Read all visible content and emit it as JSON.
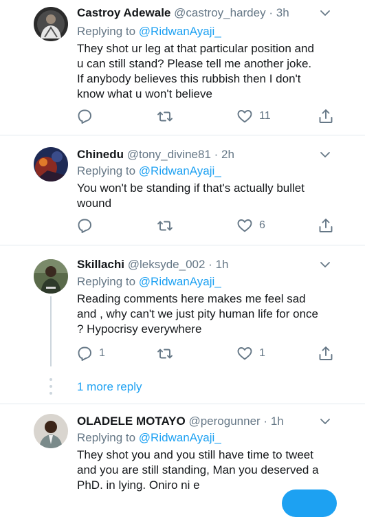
{
  "colors": {
    "accent": "#1da1f2",
    "secondary_text": "#657786",
    "primary_text": "#14171a",
    "divider": "#e1e8ed"
  },
  "icons": {
    "reply": "reply-icon",
    "retweet": "retweet-icon",
    "like": "heart-icon",
    "share": "share-icon",
    "menu": "chevron-down-icon"
  },
  "replies": [
    {
      "name": "Castroy Adewale",
      "handle": "@castroy_hardey",
      "separator": "·",
      "time": "3h",
      "replying_prefix": "Replying to ",
      "replying_to": "@RidwanAyaji_",
      "text_lines": [
        "They shot ur leg at that particular position and",
        "u can still stand? Please tell me another joke.",
        "If anybody believes this rubbish then I don't",
        "know what u won't believe"
      ],
      "reply_count": "",
      "retweet_count": "",
      "like_count": "11"
    },
    {
      "name": "Chinedu",
      "handle": "@tony_divine81",
      "separator": "·",
      "time": "2h",
      "replying_prefix": "Replying to ",
      "replying_to": "@RidwanAyaji_",
      "text_lines": [
        "You won't be standing if that's actually bullet",
        "wound"
      ],
      "reply_count": "",
      "retweet_count": "",
      "like_count": "6"
    },
    {
      "name": "Skillachi",
      "handle": "@leksyde_002",
      "separator": "·",
      "time": "1h",
      "replying_prefix": "Replying to ",
      "replying_to": "@RidwanAyaji_",
      "text_lines": [
        "Reading comments here makes me feel sad",
        "and , why can't we just pity human life for once",
        "? Hypocrisy everywhere"
      ],
      "reply_count": "1",
      "retweet_count": "",
      "like_count": "1"
    },
    {
      "name": "OLADELE MOTAYO",
      "handle": "@perogunner",
      "separator": "·",
      "time": "1h",
      "replying_prefix": "Replying to ",
      "replying_to": "@RidwanAyaji_",
      "text_lines": [
        "They shot you and you still have time to tweet",
        "and you are still standing, Man you deserved a",
        "PhD. in lying. Oniro ni e"
      ],
      "reply_count": "",
      "retweet_count": "",
      "like_count": ""
    }
  ],
  "more_replies_label": "1 more reply"
}
